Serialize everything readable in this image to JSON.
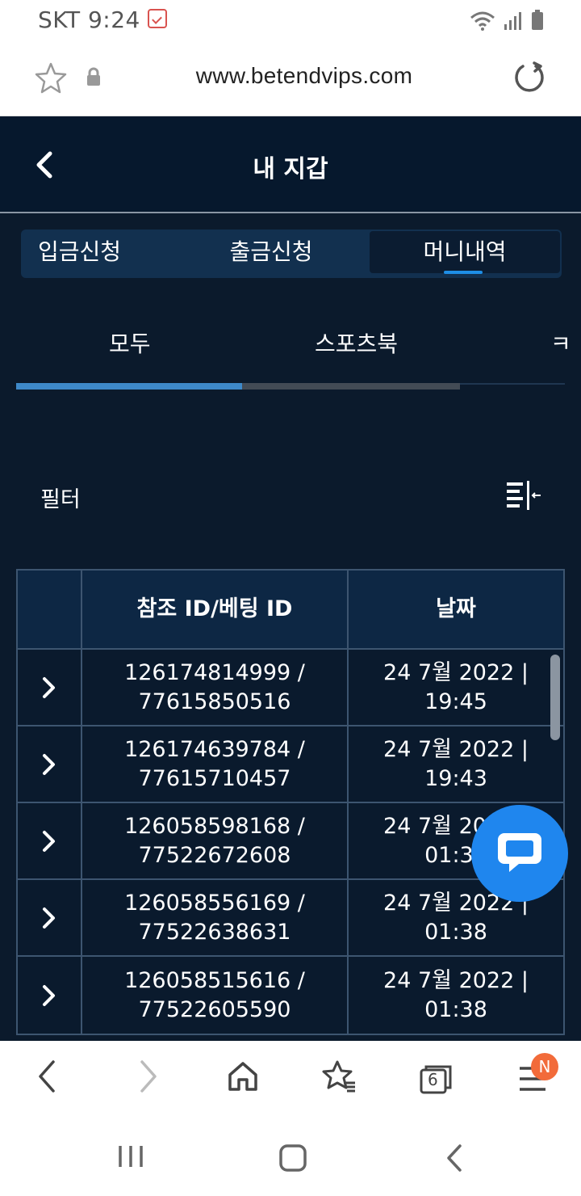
{
  "status_bar": {
    "carrier": "SKT",
    "time": "9:24"
  },
  "address_bar": {
    "url": "www.betendvips.com"
  },
  "header": {
    "title": "내 지갑"
  },
  "tabs": [
    {
      "label": "입금신청",
      "active": false
    },
    {
      "label": "출금신청",
      "active": false
    },
    {
      "label": "머니내역",
      "active": true
    }
  ],
  "subtabs": [
    {
      "label": "모두",
      "active": true
    },
    {
      "label": "스포츠북",
      "active": false
    },
    {
      "label": "ㅋ",
      "active": false
    }
  ],
  "filter": {
    "label": "필터",
    "icon": "filter-collapse-icon"
  },
  "table": {
    "headers": [
      "",
      "참조 ID/베팅 ID",
      "날짜"
    ],
    "rows": [
      {
        "ref_id": "126174814999 /",
        "bet_id": "77615850516",
        "date": "24 7월 2022 |",
        "time": "19:45"
      },
      {
        "ref_id": "126174639784 /",
        "bet_id": "77615710457",
        "date": "24 7월 2022 |",
        "time": "19:43"
      },
      {
        "ref_id": "126058598168 /",
        "bet_id": "77522672608",
        "date": "24 7월 2022 |",
        "time": "01:38"
      },
      {
        "ref_id": "126058556169 /",
        "bet_id": "77522638631",
        "date": "24 7월 2022 |",
        "time": "01:38"
      },
      {
        "ref_id": "126058515616 /",
        "bet_id": "77522605590",
        "date": "24 7월 2022 |",
        "time": "01:38"
      }
    ]
  },
  "browser_bar": {
    "tab_count": "6",
    "menu_badge": "N"
  },
  "colors": {
    "page_bg": "#0b1a2c",
    "accent": "#1e8ee6",
    "chat": "#1f86ee",
    "badge": "#f26b3a"
  }
}
